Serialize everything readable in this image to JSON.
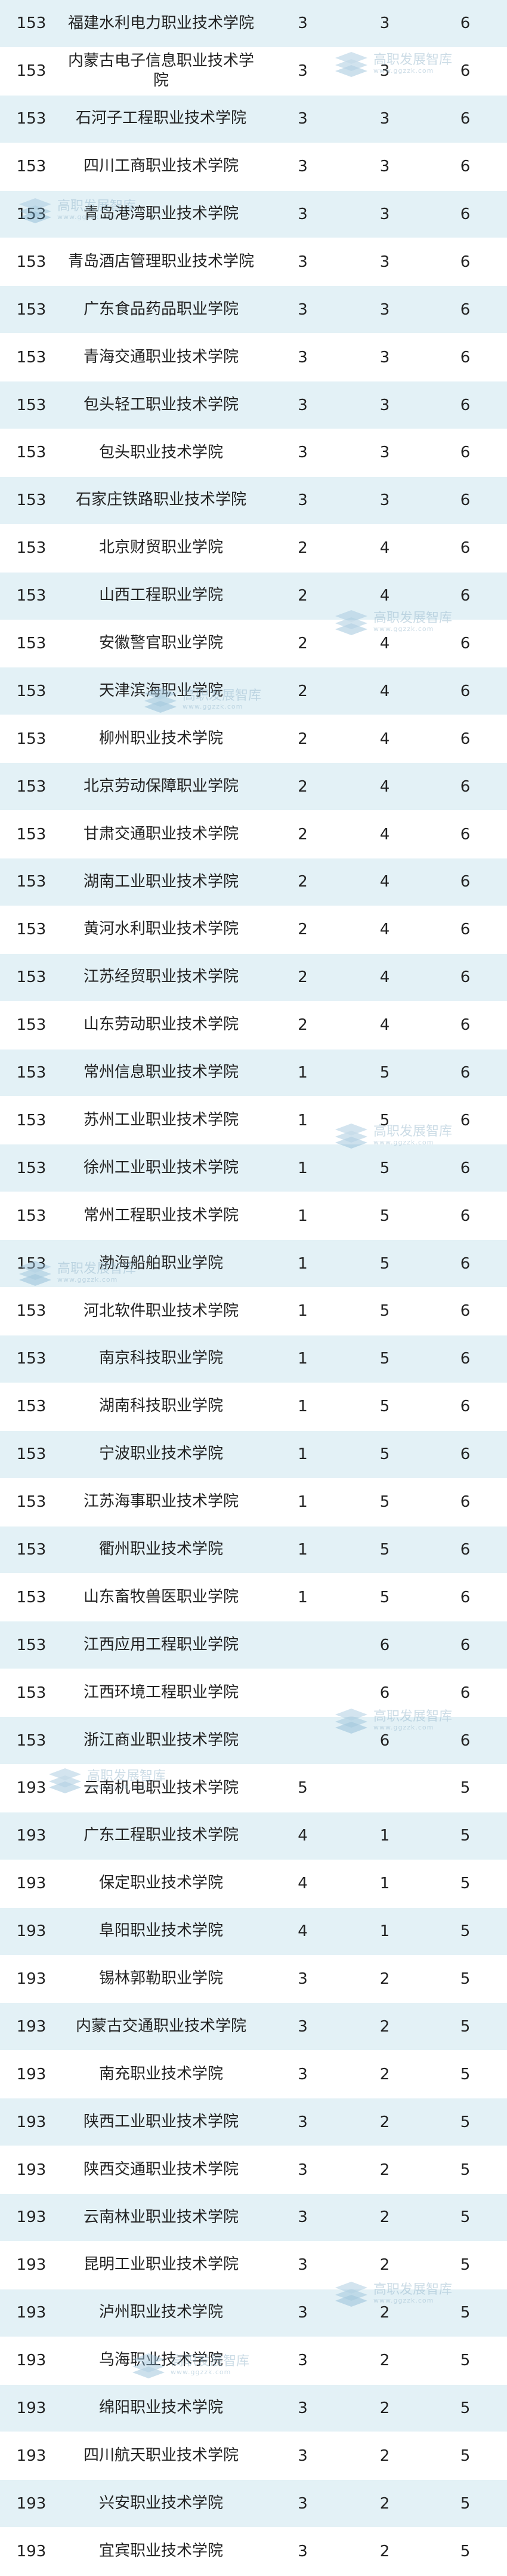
{
  "rows": [
    [
      "153",
      "福建水利电力职业技术学院",
      "3",
      "3",
      "6"
    ],
    [
      "153",
      "内蒙古电子信息职业技术学院",
      "3",
      "3",
      "6"
    ],
    [
      "153",
      "石河子工程职业技术学院",
      "3",
      "3",
      "6"
    ],
    [
      "153",
      "四川工商职业技术学院",
      "3",
      "3",
      "6"
    ],
    [
      "153",
      "青岛港湾职业技术学院",
      "3",
      "3",
      "6"
    ],
    [
      "153",
      "青岛酒店管理职业技术学院",
      "3",
      "3",
      "6"
    ],
    [
      "153",
      "广东食品药品职业学院",
      "3",
      "3",
      "6"
    ],
    [
      "153",
      "青海交通职业技术学院",
      "3",
      "3",
      "6"
    ],
    [
      "153",
      "包头轻工职业技术学院",
      "3",
      "3",
      "6"
    ],
    [
      "153",
      "包头职业技术学院",
      "3",
      "3",
      "6"
    ],
    [
      "153",
      "石家庄铁路职业技术学院",
      "3",
      "3",
      "6"
    ],
    [
      "153",
      "北京财贸职业学院",
      "2",
      "4",
      "6"
    ],
    [
      "153",
      "山西工程职业学院",
      "2",
      "4",
      "6"
    ],
    [
      "153",
      "安徽警官职业学院",
      "2",
      "4",
      "6"
    ],
    [
      "153",
      "天津滨海职业学院",
      "2",
      "4",
      "6"
    ],
    [
      "153",
      "柳州职业技术学院",
      "2",
      "4",
      "6"
    ],
    [
      "153",
      "北京劳动保障职业学院",
      "2",
      "4",
      "6"
    ],
    [
      "153",
      "甘肃交通职业技术学院",
      "2",
      "4",
      "6"
    ],
    [
      "153",
      "湖南工业职业技术学院",
      "2",
      "4",
      "6"
    ],
    [
      "153",
      "黄河水利职业技术学院",
      "2",
      "4",
      "6"
    ],
    [
      "153",
      "江苏经贸职业技术学院",
      "2",
      "4",
      "6"
    ],
    [
      "153",
      "山东劳动职业技术学院",
      "2",
      "4",
      "6"
    ],
    [
      "153",
      "常州信息职业技术学院",
      "1",
      "5",
      "6"
    ],
    [
      "153",
      "苏州工业职业技术学院",
      "1",
      "5",
      "6"
    ],
    [
      "153",
      "徐州工业职业技术学院",
      "1",
      "5",
      "6"
    ],
    [
      "153",
      "常州工程职业技术学院",
      "1",
      "5",
      "6"
    ],
    [
      "153",
      "渤海船舶职业学院",
      "1",
      "5",
      "6"
    ],
    [
      "153",
      "河北软件职业技术学院",
      "1",
      "5",
      "6"
    ],
    [
      "153",
      "南京科技职业学院",
      "1",
      "5",
      "6"
    ],
    [
      "153",
      "湖南科技职业学院",
      "1",
      "5",
      "6"
    ],
    [
      "153",
      "宁波职业技术学院",
      "1",
      "5",
      "6"
    ],
    [
      "153",
      "江苏海事职业技术学院",
      "1",
      "5",
      "6"
    ],
    [
      "153",
      "衢州职业技术学院",
      "1",
      "5",
      "6"
    ],
    [
      "153",
      "山东畜牧兽医职业学院",
      "1",
      "5",
      "6"
    ],
    [
      "153",
      "江西应用工程职业学院",
      "",
      "6",
      "6"
    ],
    [
      "153",
      "江西环境工程职业学院",
      "",
      "6",
      "6"
    ],
    [
      "153",
      "浙江商业职业技术学院",
      "",
      "6",
      "6"
    ],
    [
      "193",
      "云南机电职业技术学院",
      "5",
      "",
      "5"
    ],
    [
      "193",
      "广东工程职业技术学院",
      "4",
      "1",
      "5"
    ],
    [
      "193",
      "保定职业技术学院",
      "4",
      "1",
      "5"
    ],
    [
      "193",
      "阜阳职业技术学院",
      "4",
      "1",
      "5"
    ],
    [
      "193",
      "锡林郭勒职业学院",
      "3",
      "2",
      "5"
    ],
    [
      "193",
      "内蒙古交通职业技术学院",
      "3",
      "2",
      "5"
    ],
    [
      "193",
      "南充职业技术学院",
      "3",
      "2",
      "5"
    ],
    [
      "193",
      "陕西工业职业技术学院",
      "3",
      "2",
      "5"
    ],
    [
      "193",
      "陕西交通职业技术学院",
      "3",
      "2",
      "5"
    ],
    [
      "193",
      "云南林业职业技术学院",
      "3",
      "2",
      "5"
    ],
    [
      "193",
      "昆明工业职业技术学院",
      "3",
      "2",
      "5"
    ],
    [
      "193",
      "泸州职业技术学院",
      "3",
      "2",
      "5"
    ],
    [
      "193",
      "乌海职业技术学院",
      "3",
      "2",
      "5"
    ],
    [
      "193",
      "绵阳职业技术学院",
      "3",
      "2",
      "5"
    ],
    [
      "193",
      "四川航天职业技术学院",
      "3",
      "2",
      "5"
    ],
    [
      "193",
      "兴安职业技术学院",
      "3",
      "2",
      "5"
    ],
    [
      "193",
      "宜宾职业技术学院",
      "3",
      "2",
      "5"
    ]
  ],
  "watermark": {
    "title": "高职发展智库",
    "url": "www.ggzzk.com"
  }
}
